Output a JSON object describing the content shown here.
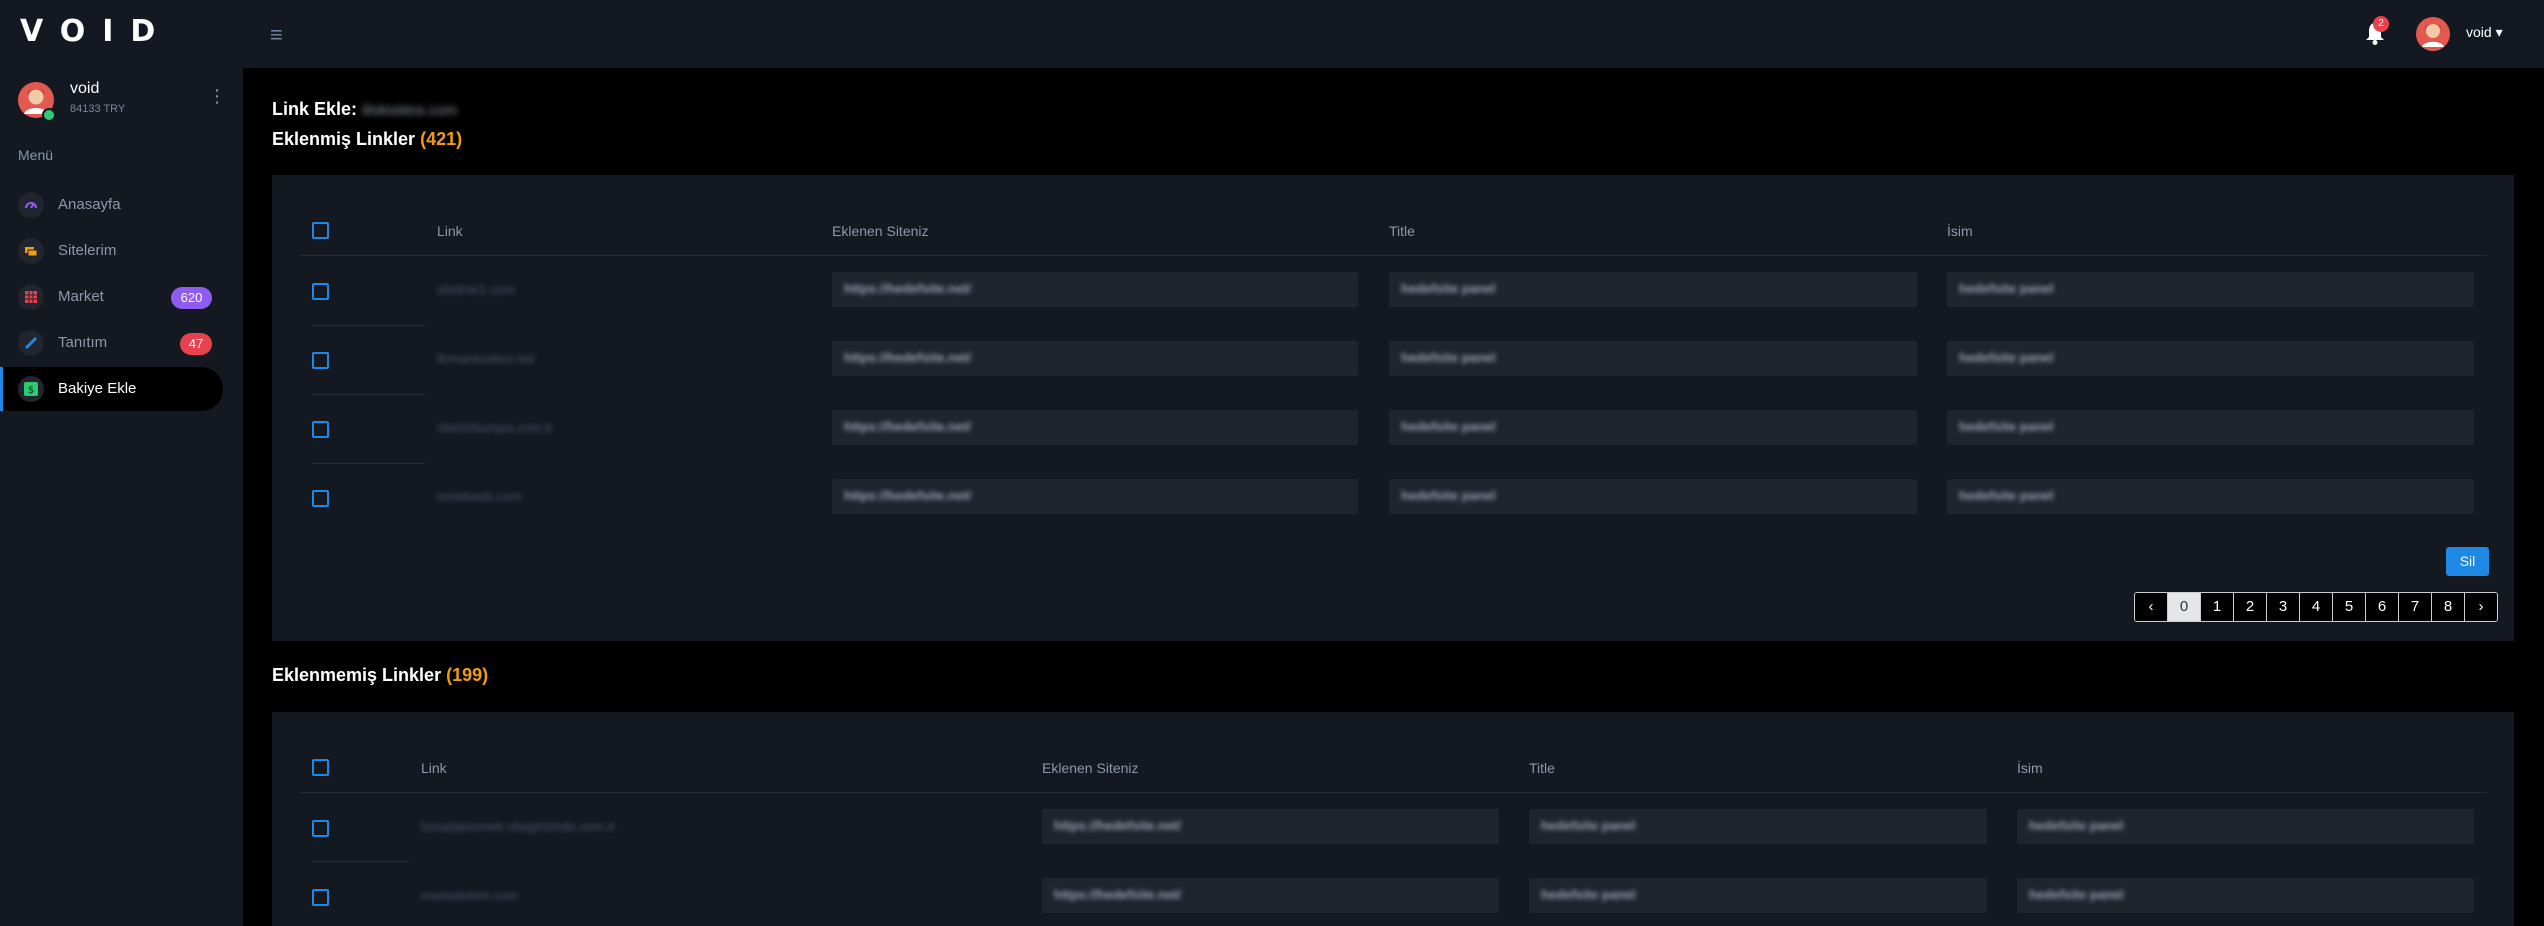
{
  "app": {
    "logo": "VOID"
  },
  "topbar": {
    "menu_icon": "hamburger-icon",
    "notification_count": "2",
    "username": "void ▾"
  },
  "sidebar": {
    "user": {
      "name": "void",
      "balance": "84133 TRY"
    },
    "menu_title": "Menü",
    "items": [
      {
        "label": "Anasayfa",
        "icon": "gauge-icon",
        "color": "#9b59ff"
      },
      {
        "label": "Sitelerim",
        "icon": "cards-icon",
        "color": "#f39c12"
      },
      {
        "label": "Market",
        "icon": "grid-icon",
        "color": "#e8424f",
        "badge": "620",
        "badge_color": "#8e5cf0"
      },
      {
        "label": "Tanıtım",
        "icon": "pen-icon",
        "color": "#1e88e5",
        "badge": "47",
        "badge_color": "#e8424f"
      },
      {
        "label": "Bakiye Ekle",
        "icon": "dollar-icon",
        "color": "#2ecc71",
        "active": true
      }
    ]
  },
  "main": {
    "link_ekle": {
      "label": "Link Ekle:",
      "value": "iliskisitesi.com"
    },
    "added": {
      "title": "Eklenmiş Linkler",
      "count": "(421)",
      "columns": [
        "Link",
        "Eklenen Siteniz",
        "Title",
        "İsim"
      ],
      "rows": [
        {
          "link": "sitelinki1.com",
          "site": "https://hedefsite.net/",
          "title": "hedefsite panel",
          "name": "hedefsite panel"
        },
        {
          "link": "firmaninsitesi.net",
          "site": "https://hedefsite.net/",
          "title": "hedefsite panel",
          "name": "hedefsite panel"
        },
        {
          "link": "sitenizburaya.com.tr",
          "site": "https://hedefsite.net/",
          "title": "hedefsite panel",
          "name": "hedefsite panel"
        },
        {
          "link": "ornekweb.com",
          "site": "https://hedefsite.net/",
          "title": "hedefsite panel",
          "name": "hedefsite panel"
        }
      ],
      "delete_label": "Sil",
      "pagination": {
        "prev": "‹",
        "pages": [
          "0",
          "1",
          "2",
          "3",
          "4",
          "5",
          "6",
          "7",
          "8"
        ],
        "next": "›",
        "current": "0"
      }
    },
    "not_added": {
      "title": "Eklenmemiş Linkler",
      "count": "(199)",
      "columns": [
        "Link",
        "Eklenen Siteniz",
        "Title",
        "İsim"
      ],
      "rows": [
        {
          "link": "buradakiornek.sitegirisinde.com.tr",
          "site": "https://hedefsite.net/",
          "title": "hedefsite panel",
          "name": "hedefsite panel"
        },
        {
          "link": "markalinkim.com",
          "site": "https://hedefsite.net/",
          "title": "hedefsite panel",
          "name": "hedefsite panel"
        }
      ]
    }
  }
}
